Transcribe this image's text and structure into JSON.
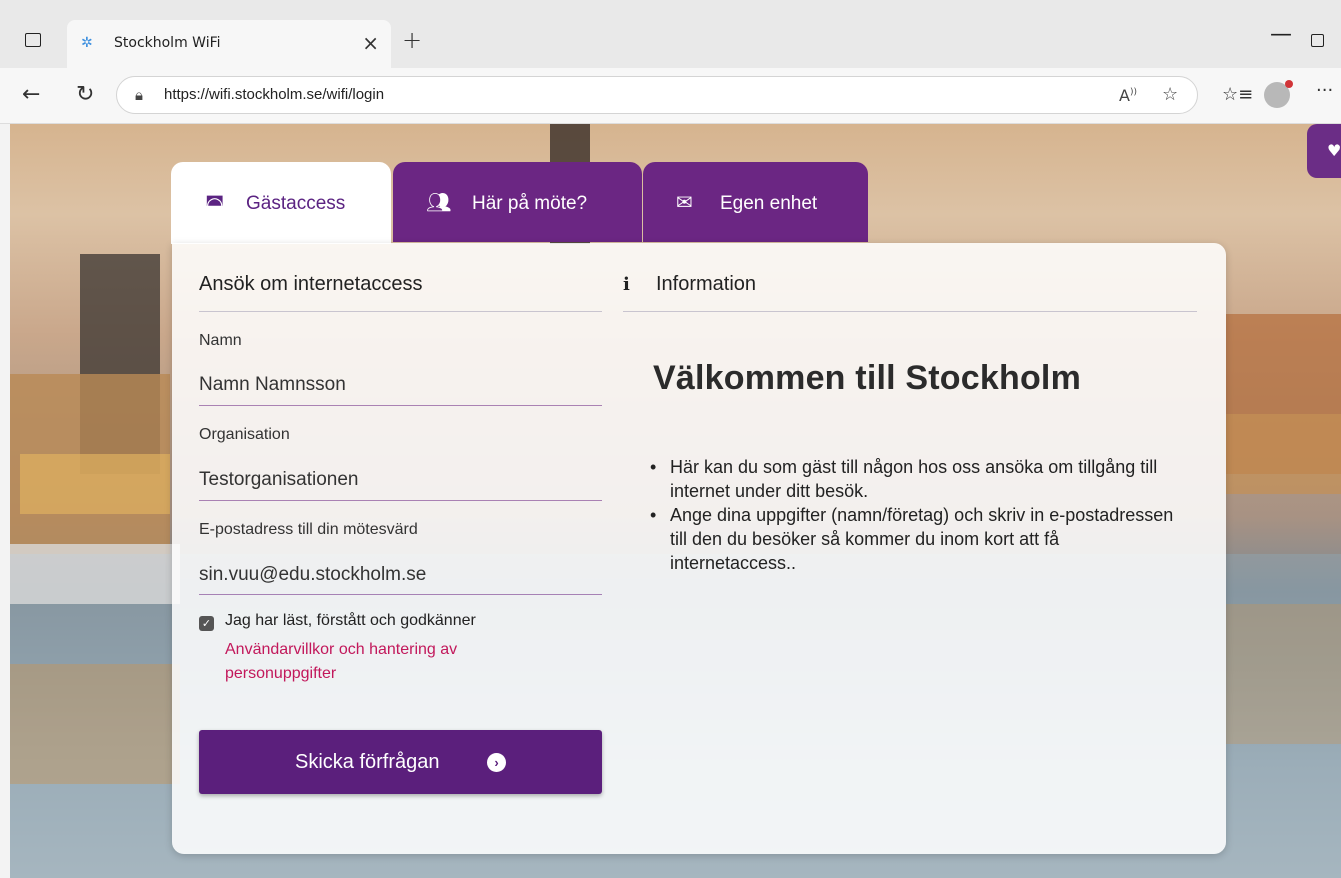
{
  "browser": {
    "tab_title": "Stockholm WiFi",
    "url": "https://wifi.stockholm.se/wifi/login",
    "read_aloud_label": "A)"
  },
  "tabs": [
    {
      "label": "Gästaccess",
      "icon": "inbox-icon",
      "active": true
    },
    {
      "label": "Här på möte?",
      "icon": "users-icon",
      "active": false
    },
    {
      "label": "Egen enhet",
      "icon": "envelope-icon",
      "active": false
    }
  ],
  "form": {
    "title": "Ansök om internetaccess",
    "name_label": "Namn",
    "name_value": "Namn Namnsson",
    "org_label": "Organisation",
    "org_value": "Testorganisationen",
    "host_email_label": "E-postadress till din mötesvärd",
    "host_email_value": "sin.vuu@edu.stockholm.se",
    "consent_checked": true,
    "consent_text": "Jag har läst, förstått och godkänner",
    "terms_link": "Användarvillkor och hantering av personuppgifter",
    "submit_label": "Skicka förfrågan"
  },
  "info": {
    "title": "Information",
    "welcome_heading": "Välkommen till Stockholm",
    "bullets": [
      "Här kan du som gäst till någon hos oss ansöka om tillgång till internet under ditt besök.",
      "Ange dina uppgifter (namn/företag) och skriv in e-postadressen till den du besöker så kommer du inom kort att få internetaccess.."
    ]
  },
  "colors": {
    "brand_purple": "#6b2683",
    "button_purple": "#5b1f7c",
    "link_color": "#c2185b"
  }
}
